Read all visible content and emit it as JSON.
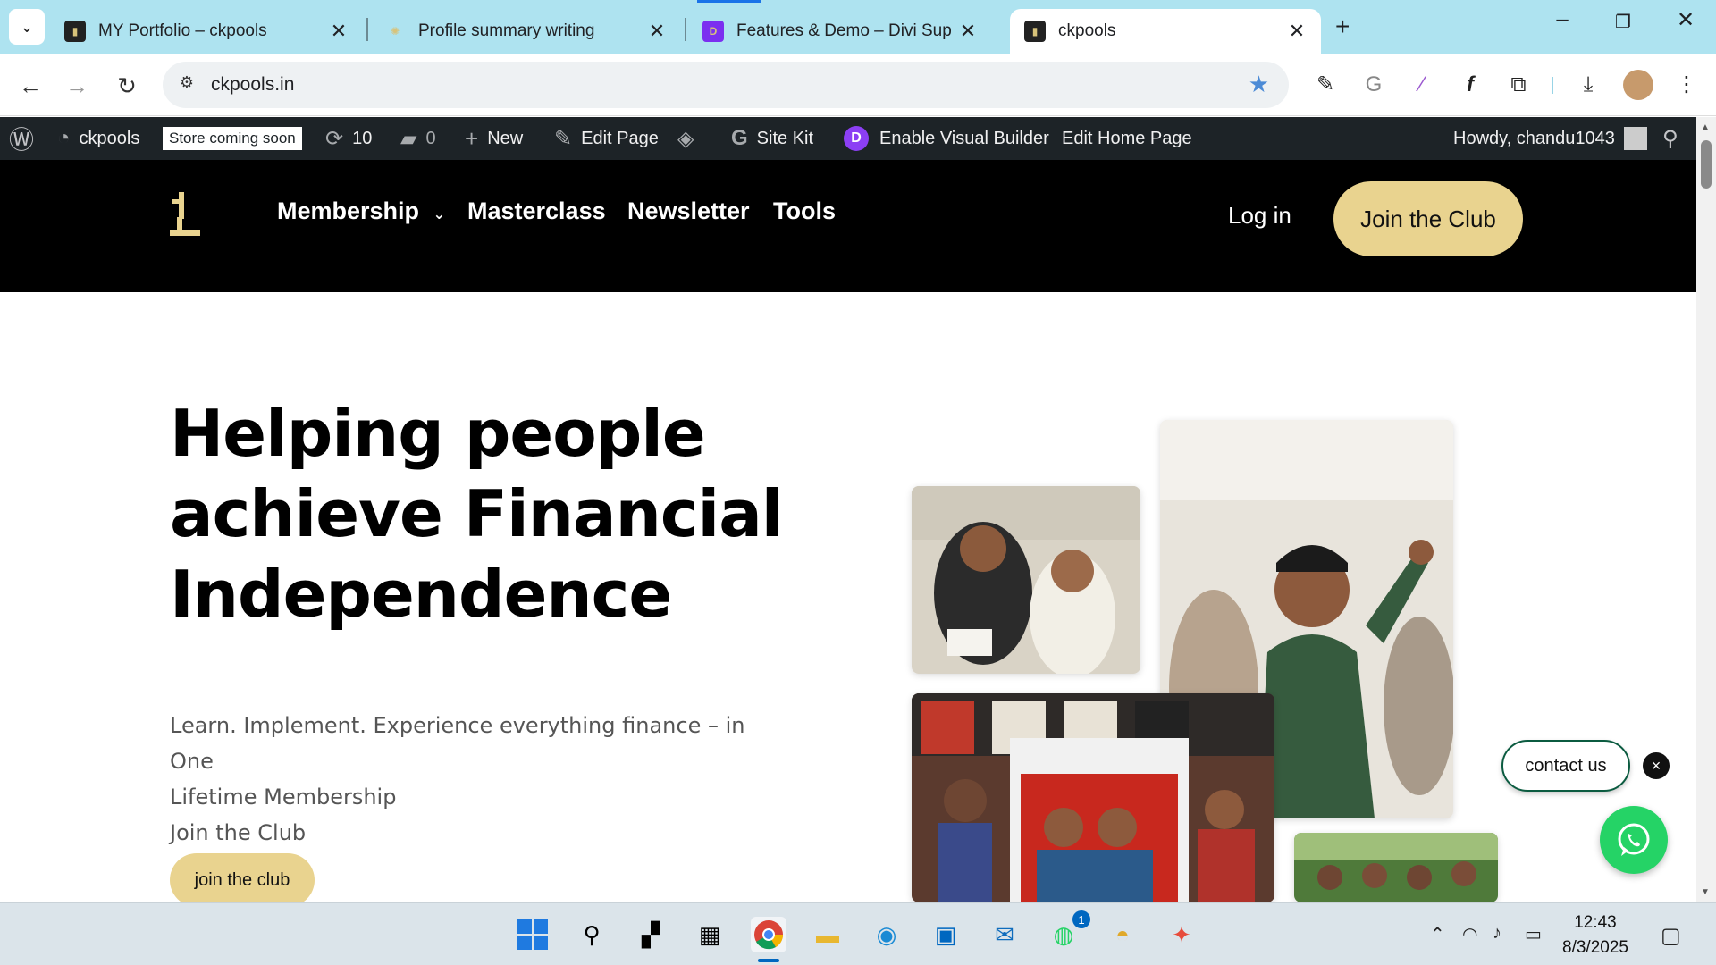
{
  "browser": {
    "tabs": [
      {
        "title": "MY Portfolio – ckpools",
        "favicon": "ckpools-favicon",
        "active": false
      },
      {
        "title": "Profile summary writing",
        "favicon": "chatgpt-icon",
        "active": false
      },
      {
        "title": "Features & Demo – Divi Supren",
        "favicon": "divi-supreme-icon",
        "active": false
      },
      {
        "title": "ckpools",
        "favicon": "ckpools-favicon",
        "active": true
      }
    ],
    "url": "ckpools.in"
  },
  "wp_admin_bar": {
    "site_name": "ckpools",
    "store_badge": "Store coming soon",
    "updates_count": "10",
    "comments_count": "0",
    "new_label": "New",
    "edit_page_label": "Edit Page",
    "site_kit_label": "Site Kit",
    "visual_builder_label": "Enable Visual Builder",
    "edit_home_label": "Edit Home Page",
    "howdy": "Howdy, chandu1043"
  },
  "site_header": {
    "menu": [
      "Membership",
      "Masterclass",
      "Newsletter",
      "Tools"
    ],
    "login_label": "Log in",
    "join_label": "Join the Club"
  },
  "hero": {
    "title_lines": [
      "Helping people",
      "achieve Financial",
      "Independence"
    ],
    "subtitle_lines": [
      "Learn. Implement. Experience everything finance – in One",
      "Lifetime Membership",
      "Join the Club"
    ],
    "button_label": "join the club"
  },
  "widgets": {
    "contact_label": "contact us",
    "close_glyph": "×"
  },
  "taskbar": {
    "time": "12:43",
    "date": "8/3/2025",
    "whatsapp_badge": "1"
  },
  "colors": {
    "accent_gold": "#e9d38f",
    "header_bg": "#000000",
    "wp_bar_bg": "#1d2327",
    "tabstrip_bg": "#aee3f0",
    "whatsapp_green": "#25d366"
  }
}
